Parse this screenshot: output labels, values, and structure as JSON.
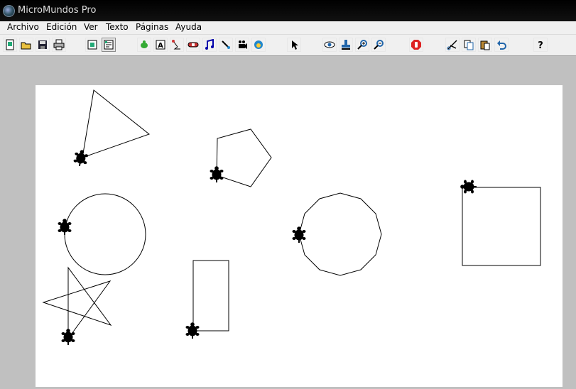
{
  "window": {
    "title": "MicroMundos Pro"
  },
  "menu": {
    "items": [
      "Archivo",
      "Edición",
      "Ver",
      "Texto",
      "Páginas",
      "Ayuda"
    ]
  },
  "toolbar": {
    "buttons": [
      "new-page-icon",
      "open-icon",
      "save-icon",
      "print-icon",
      "page-view-icon",
      "procedures-icon",
      "new-turtle-icon",
      "text-box-icon",
      "button-icon",
      "slider-icon",
      "music-icon",
      "sound-icon",
      "video-icon",
      "paint-tools-icon",
      "pointer-icon",
      "eye-icon",
      "stamp-icon",
      "zoom-in-icon",
      "zoom-out-icon",
      "stop-icon",
      "cut-icon",
      "copy-icon",
      "paste-icon",
      "undo-icon",
      "help-icon"
    ]
  },
  "colors": {
    "titlebar": "#000000",
    "workspace": "#c0c0c0",
    "page": "#ffffff",
    "turtle": "#000000"
  }
}
